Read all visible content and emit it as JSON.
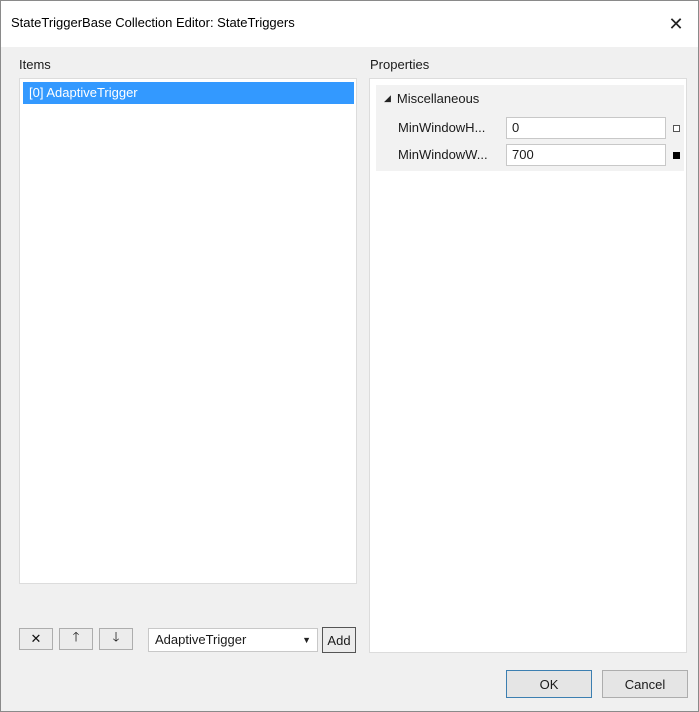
{
  "window": {
    "title": "StateTriggerBase Collection Editor: StateTriggers",
    "close_glyph": "✕"
  },
  "items_panel": {
    "label": "Items",
    "items": [
      {
        "label": "[0] AdaptiveTrigger",
        "selected": true
      }
    ]
  },
  "properties_panel": {
    "label": "Properties",
    "category": {
      "expand_glyph": "◢",
      "name": "Miscellaneous",
      "properties": [
        {
          "name": "MinWindowH...",
          "value": "0",
          "is_set": false
        },
        {
          "name": "MinWindowW...",
          "value": "700",
          "is_set": true
        }
      ]
    }
  },
  "toolbar": {
    "remove_icon": "✕",
    "move_up_icon": "🡑",
    "move_down_icon": "🡓",
    "type_combo_value": "AdaptiveTrigger",
    "type_combo_arrow": "▼",
    "add_label": "Add"
  },
  "footer": {
    "ok_label": "OK",
    "cancel_label": "Cancel"
  },
  "colors": {
    "selection": "#3399ff",
    "client_bg": "#f0f0f0"
  }
}
